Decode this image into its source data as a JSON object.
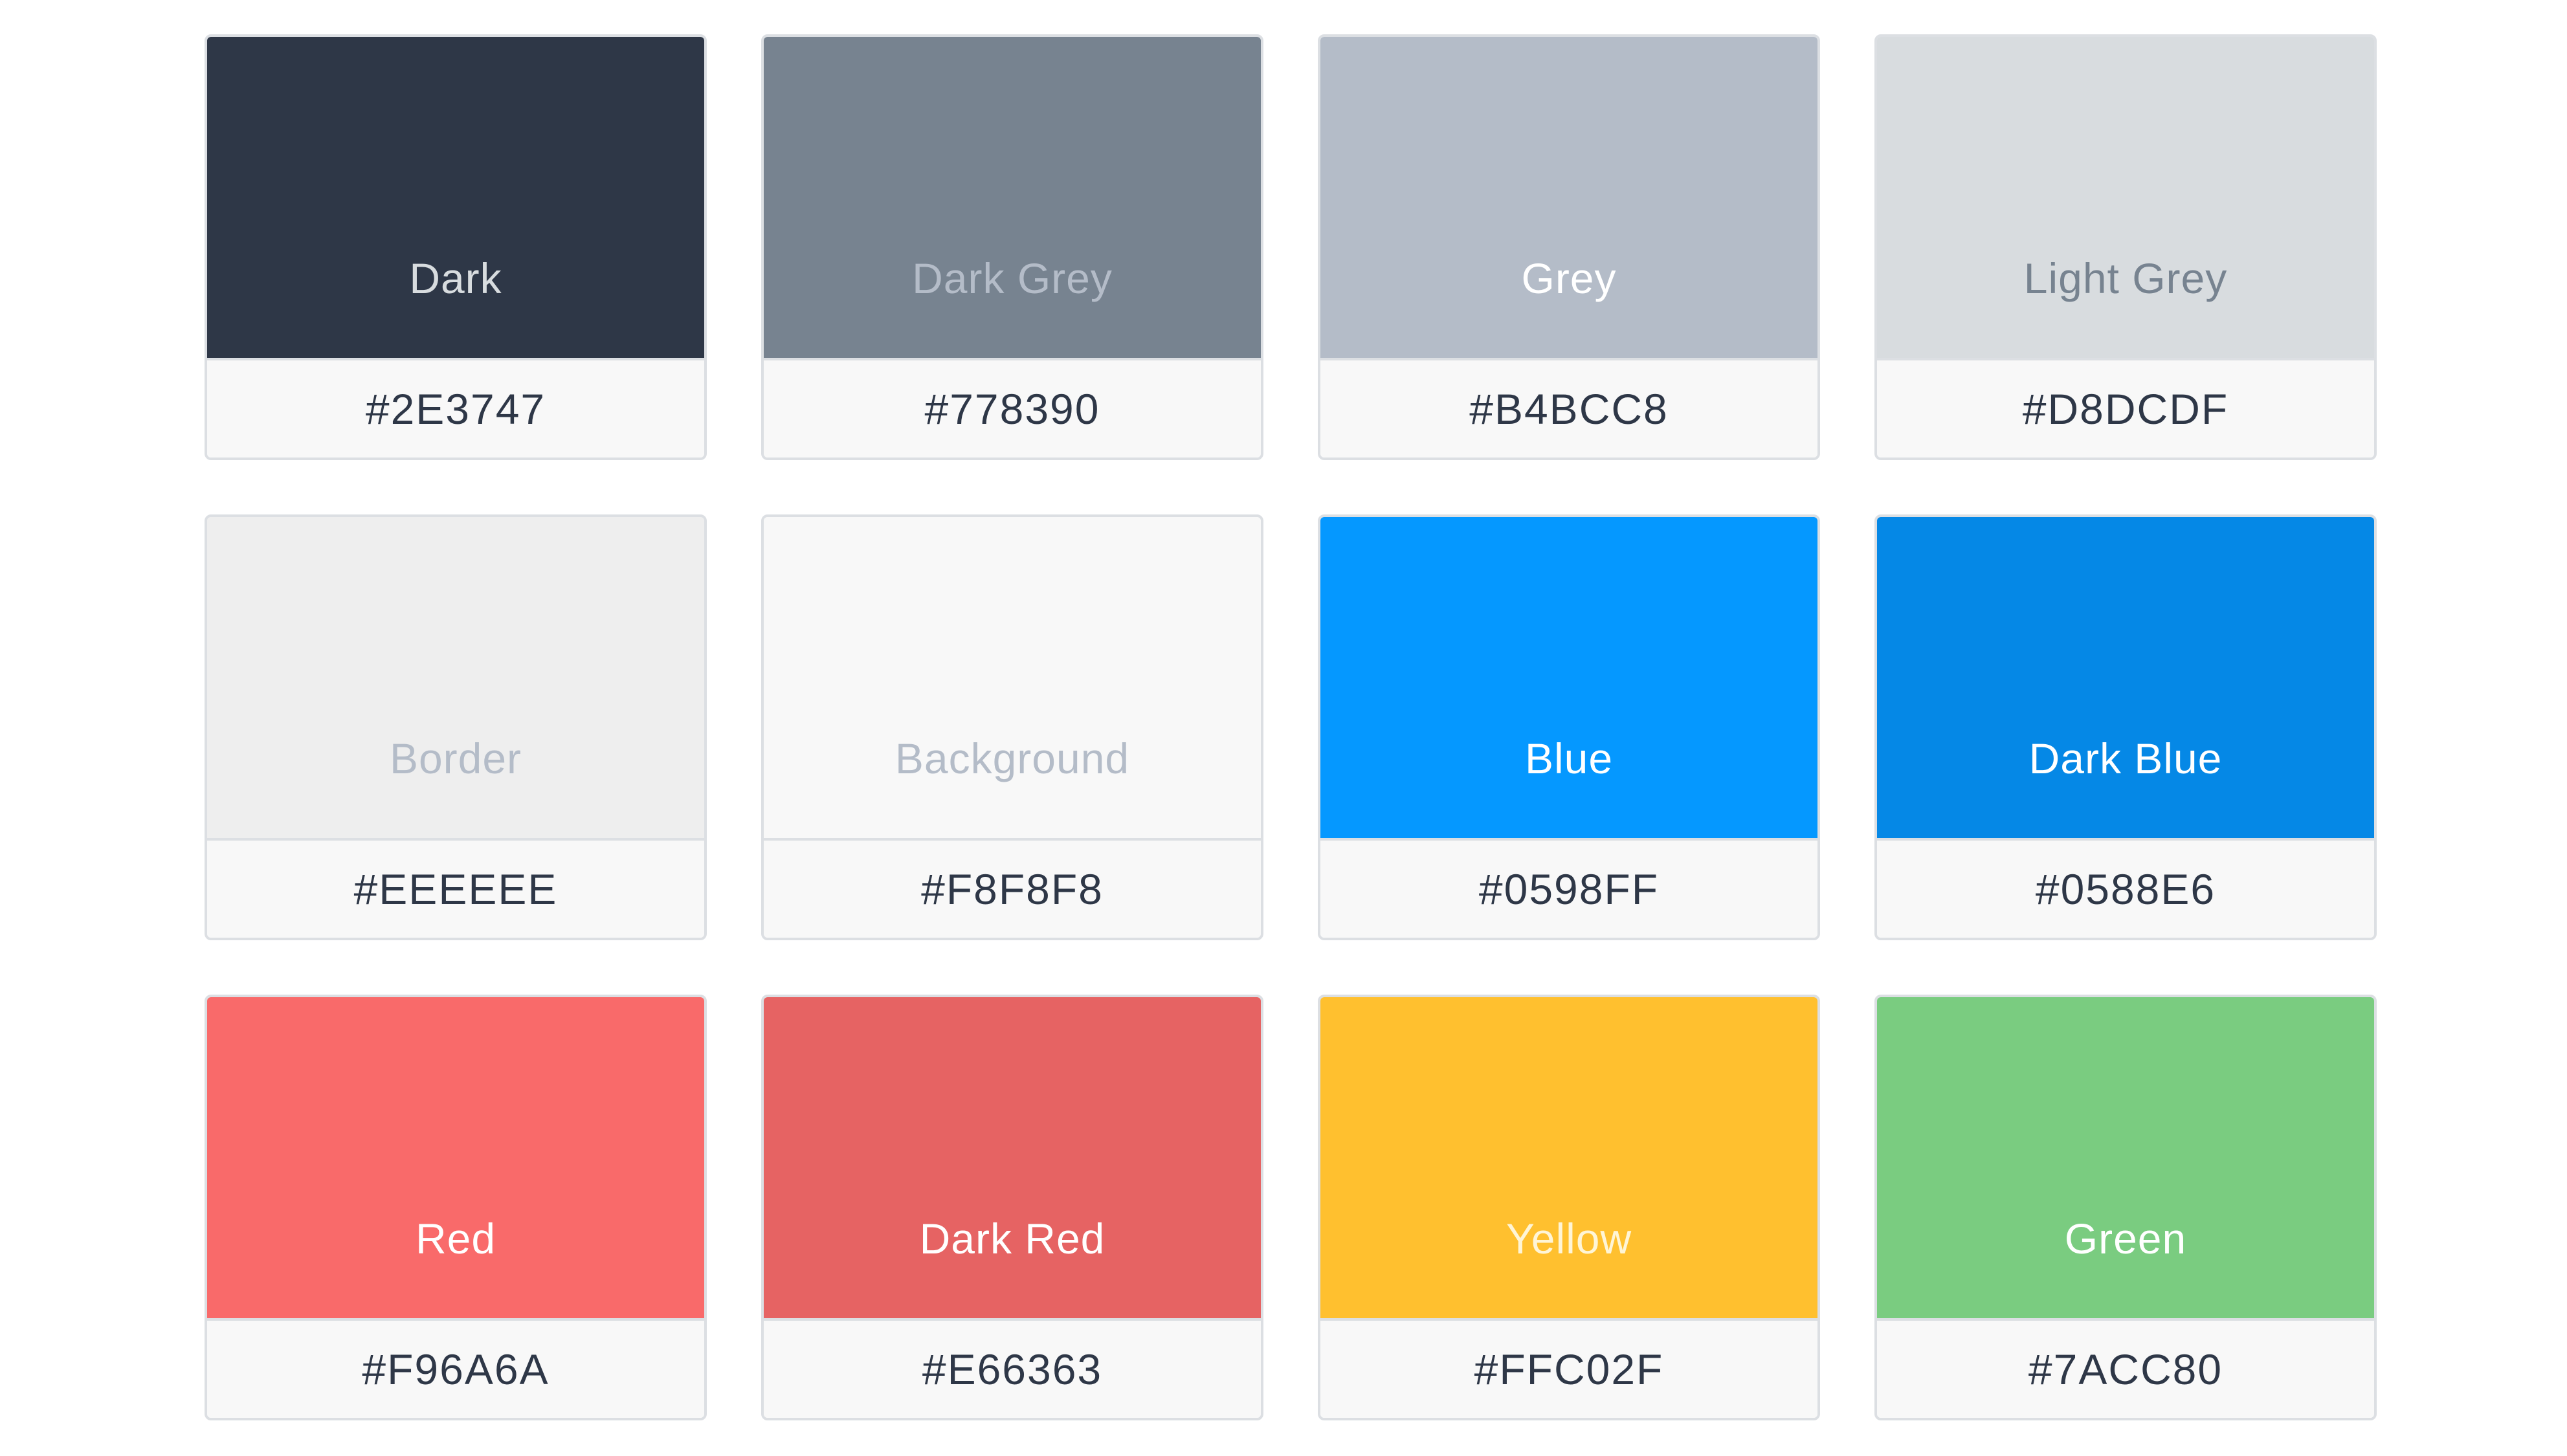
{
  "swatches": [
    {
      "name": "Dark",
      "hex": "#2E3747",
      "color": "#2E3747",
      "text_color": "#d8dcdf"
    },
    {
      "name": "Dark Grey",
      "hex": "#778390",
      "color": "#778390",
      "text_color": "#b4bcc8"
    },
    {
      "name": "Grey",
      "hex": "#B4BCC8",
      "color": "#B4BCC8",
      "text_color": "#ffffff"
    },
    {
      "name": "Light Grey",
      "hex": "#D8DCDF",
      "color": "#D8DCDF",
      "text_color": "#778390"
    },
    {
      "name": "Border",
      "hex": "#EEEEEE",
      "color": "#EEEEEE",
      "text_color": "#b4bcc8"
    },
    {
      "name": "Background",
      "hex": "#F8F8F8",
      "color": "#F8F8F8",
      "text_color": "#b4bcc8"
    },
    {
      "name": "Blue",
      "hex": "#0598FF",
      "color": "#0598FF",
      "text_color": "#ffffff"
    },
    {
      "name": "Dark Blue",
      "hex": "#0588E6",
      "color": "#0588E6",
      "text_color": "#ffffff"
    },
    {
      "name": "Red",
      "hex": "#F96A6A",
      "color": "#F96A6A",
      "text_color": "#ffffff"
    },
    {
      "name": "Dark Red",
      "hex": "#E66363",
      "color": "#E66363",
      "text_color": "#ffffff"
    },
    {
      "name": "Yellow",
      "hex": "#FFC02F",
      "color": "#FFC02F",
      "text_color": "#fff5d6"
    },
    {
      "name": "Green",
      "hex": "#7ACC80",
      "color": "#7ACC80",
      "text_color": "#ffffff"
    }
  ]
}
